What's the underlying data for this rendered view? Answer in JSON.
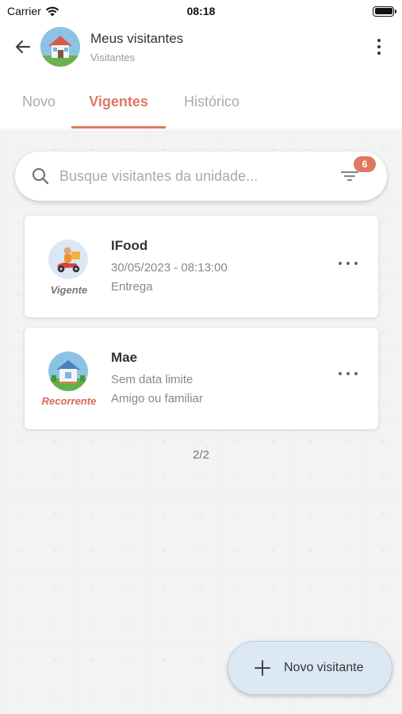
{
  "status_bar": {
    "carrier": "Carrier",
    "time": "08:18"
  },
  "header": {
    "title": "Meus visitantes",
    "subtitle": "Visitantes"
  },
  "tabs": [
    {
      "label": "Novo"
    },
    {
      "label": "Vigentes",
      "active": true
    },
    {
      "label": "Histórico"
    }
  ],
  "search": {
    "placeholder": "Busque visitantes da unidade...",
    "value": "",
    "filter_count": "6"
  },
  "visitors": [
    {
      "name": "IFood",
      "line2": "30/05/2023 - 08:13:00",
      "line3": "Entrega",
      "status": "Vigente",
      "icon": "delivery-icon"
    },
    {
      "name": "Mae",
      "line2": "Sem data limite",
      "line3": "Amigo ou familiar",
      "status": "Recorrente",
      "icon": "house-icon"
    }
  ],
  "pager": "2/2",
  "fab": {
    "label": "Novo visitante"
  },
  "colors": {
    "accent": "#e0785f",
    "fab_bg": "#dce8f4"
  }
}
